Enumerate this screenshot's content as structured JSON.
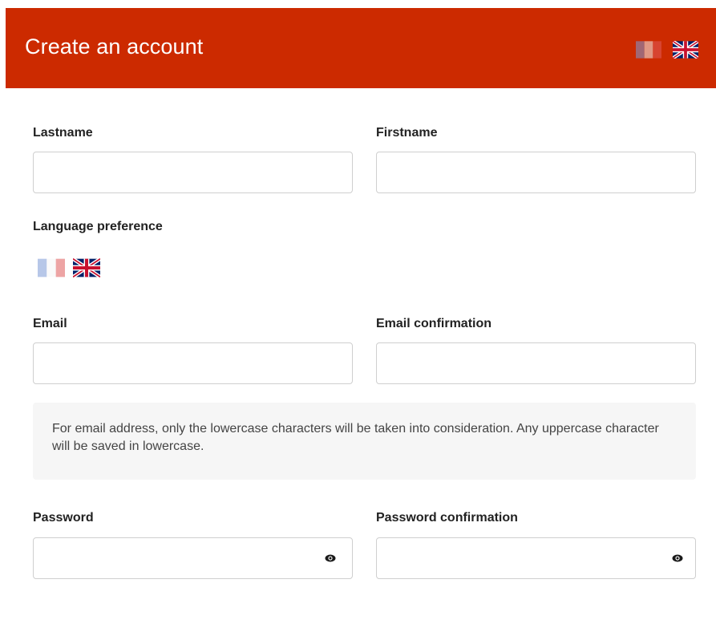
{
  "header": {
    "title": "Create an account",
    "flags": [
      {
        "code": "fr",
        "icon": "france-flag-icon"
      },
      {
        "code": "en",
        "icon": "uk-flag-icon"
      }
    ],
    "background_color": "#cc2a00"
  },
  "form": {
    "lastname_label": "Lastname",
    "lastname_value": "",
    "firstname_label": "Firstname",
    "firstname_value": "",
    "language_label": "Language preference",
    "language_options": [
      {
        "code": "fr",
        "icon": "france-flag-icon"
      },
      {
        "code": "en",
        "icon": "uk-flag-icon"
      }
    ],
    "email_label": "Email",
    "email_value": "",
    "email_confirmation_label": "Email confirmation",
    "email_confirmation_value": "",
    "email_notice": "For email address, only the lowercase characters will be taken into consideration. Any uppercase character will be saved in lowercase.",
    "password_label": "Password",
    "password_value": "",
    "password_confirmation_label": "Password confirmation",
    "password_confirmation_value": "",
    "password_toggle_icon": "eye-icon"
  }
}
